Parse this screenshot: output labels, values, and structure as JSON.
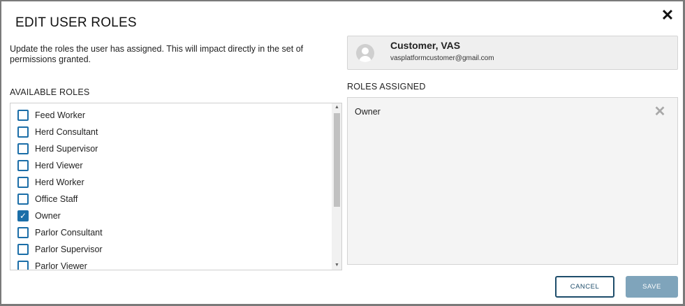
{
  "modal": {
    "title": "EDIT USER ROLES",
    "close_glyph": "✕",
    "description": "Update the roles the user has assigned. This will impact directly in the set of permissions granted."
  },
  "available": {
    "label": "AVAILABLE ROLES",
    "roles": [
      {
        "label": "Feed Worker",
        "checked": false
      },
      {
        "label": "Herd Consultant",
        "checked": false
      },
      {
        "label": "Herd Supervisor",
        "checked": false
      },
      {
        "label": "Herd Viewer",
        "checked": false
      },
      {
        "label": "Herd Worker",
        "checked": false
      },
      {
        "label": "Office Staff",
        "checked": false
      },
      {
        "label": "Owner",
        "checked": true
      },
      {
        "label": "Parlor Consultant",
        "checked": false
      },
      {
        "label": "Parlor Supervisor",
        "checked": false
      },
      {
        "label": "Parlor Viewer",
        "checked": false
      }
    ],
    "scroll_up_glyph": "▲",
    "scroll_down_glyph": "▼"
  },
  "user": {
    "name": "Customer, VAS",
    "email": "vasplatformcustomer@gmail.com"
  },
  "assigned": {
    "label": "ROLES ASSIGNED",
    "roles": [
      {
        "label": "Owner",
        "remove_glyph": "✕"
      }
    ]
  },
  "actions": {
    "cancel_label": "CANCEL",
    "save_label": "SAVE"
  },
  "colors": {
    "checkbox": "#1b6ea8",
    "cancel_border": "#1e4d6b",
    "save_bg": "#7fa4bb"
  },
  "icons": {
    "close": "close-icon",
    "check": "check-icon",
    "avatar": "user-avatar-icon",
    "remove": "remove-icon"
  }
}
